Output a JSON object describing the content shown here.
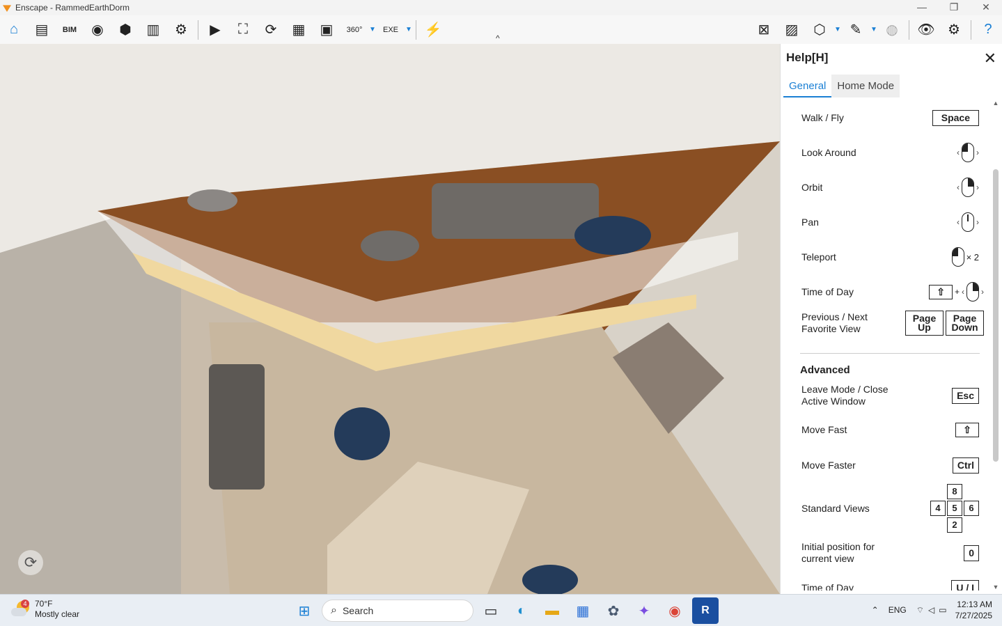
{
  "window": {
    "title": "Enscape - RammedEarthDorm",
    "controls": [
      "—",
      "❐",
      "✕"
    ]
  },
  "toolbar": {
    "left_icons": [
      "home-icon",
      "project-icon",
      "bim-icon",
      "view-icon",
      "asset-icon",
      "material-icon",
      "settings-icon"
    ],
    "mid_icons": [
      "section-icon",
      "crop-icon",
      "orbit-icon",
      "image-icon",
      "video-icon",
      "panorama-icon",
      "export-icon",
      "live-update-icon"
    ],
    "right_icons": [
      "material-editor-icon",
      "gallery-icon",
      "cube-icon",
      "brush-icon",
      "vr-icon",
      "visibility-icon",
      "settings-gear-icon",
      "help-icon"
    ],
    "collapse_label": "^"
  },
  "help_panel": {
    "title": "Help[H]",
    "close": "✕",
    "tabs": [
      "General",
      "Home Mode"
    ],
    "rows": [
      {
        "label": "Walk / Fly",
        "key": "Space"
      },
      {
        "label": "Look Around",
        "key": "mouse-left"
      },
      {
        "label": "Orbit",
        "key": "mouse-right"
      },
      {
        "label": "Pan",
        "key": "mouse-middle"
      },
      {
        "label": "Teleport",
        "key": "mouse-double",
        "suffix": "× 2"
      },
      {
        "label": "Time of Day",
        "key": "shift-plus-mouse",
        "plus": "+"
      },
      {
        "label": "Previous / Next Favorite View",
        "key1": "Page Up",
        "key2": "Page Down"
      }
    ],
    "advanced_title": "Advanced",
    "advanced_rows": [
      {
        "label": "Leave Mode / Close Active Window",
        "key": "Esc"
      },
      {
        "label": "Move Fast",
        "key": "⇧"
      },
      {
        "label": "Move Faster",
        "key": "Ctrl"
      },
      {
        "label": "Standard Views",
        "numpad": [
          "8",
          "4",
          "5",
          "6",
          "2"
        ]
      },
      {
        "label": "Initial position for current view",
        "key": "0"
      },
      {
        "label": "Time of Day",
        "key": "U / I"
      }
    ]
  },
  "taskbar": {
    "weather_temp": "70°F",
    "weather_desc": "Mostly clear",
    "weather_badge": "4",
    "search_placeholder": "Search",
    "language": "ENG",
    "time": "12:13 AM",
    "date": "7/27/2025"
  }
}
